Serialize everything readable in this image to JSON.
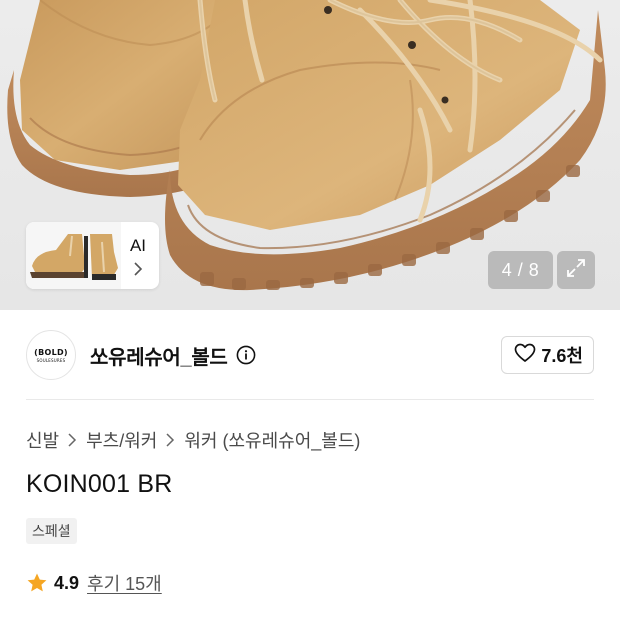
{
  "gallery": {
    "ai_label": "AI",
    "counter": "4 / 8",
    "icons": {
      "next": "chevron-right-icon",
      "expand": "expand-icon"
    }
  },
  "brand": {
    "logo_text": "(BOLD)",
    "logo_subtext": "SOULESURES",
    "name": "쏘유레슈어_볼드",
    "likes": "7.6천",
    "icons": {
      "info": "info-icon",
      "like": "heart-icon"
    }
  },
  "breadcrumb": {
    "items": [
      "신발",
      "부츠/워커",
      "워커 (쏘유레슈어_볼드)"
    ]
  },
  "product": {
    "title": "KOIN001 BR",
    "tag": "스페셜"
  },
  "rating": {
    "score": "4.9",
    "reviews_label": "후기 15개",
    "star_color": "#f5a623"
  },
  "colors": {
    "suede": "#d4a86a",
    "sole": "#b9855a"
  }
}
